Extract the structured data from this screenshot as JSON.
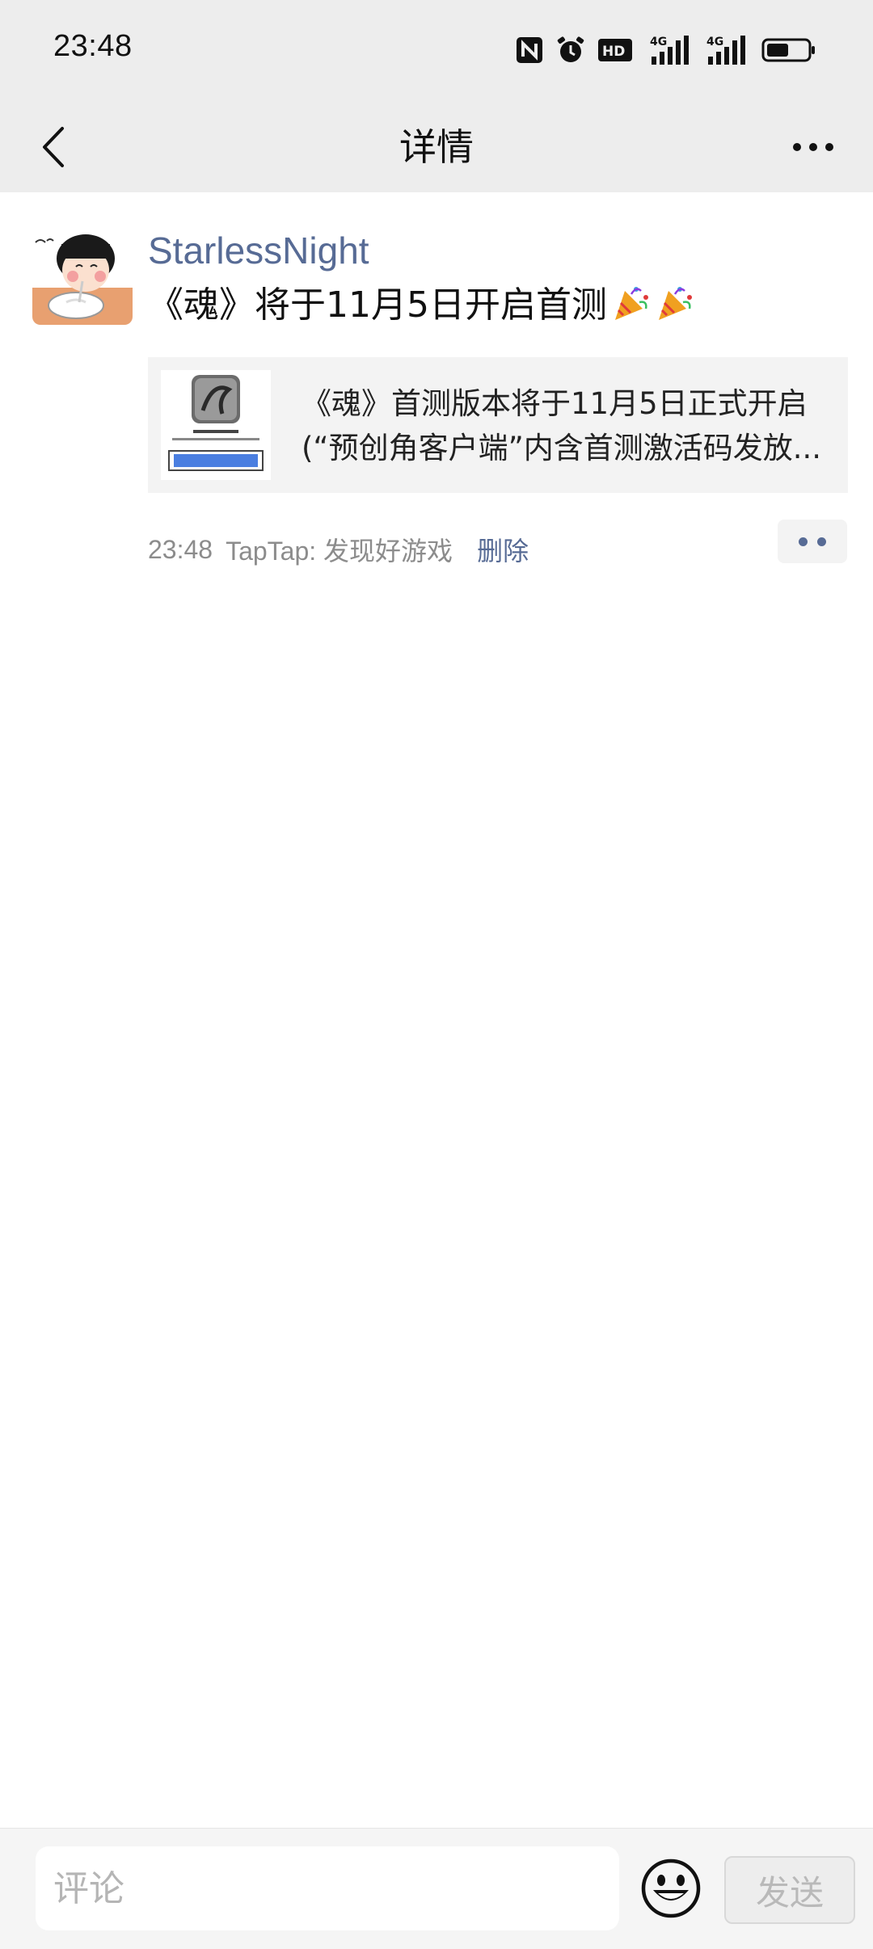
{
  "status_bar": {
    "time": "23:48",
    "icons": [
      "nfc-icon",
      "alarm-icon",
      "hd-icon",
      "signal-4g-icon",
      "signal-4g-icon",
      "battery-icon"
    ],
    "network_label_1": "4G",
    "network_label_2": "4G",
    "hd_label": "HD"
  },
  "nav": {
    "title": "详情",
    "back_icon": "chevron-left-icon",
    "more_icon": "more-icon"
  },
  "post": {
    "author": "StarlessNight",
    "text": "《魂》将于11月5日开启首测",
    "emoji": "party-popper-icon",
    "link_card": {
      "line1": "《魂》首测版本将于11月5日正式开启",
      "line2": "(“预创角客户端”内含首测激活码发放..."
    },
    "time": "23:48",
    "source": "TapTap: 发现好游戏",
    "delete_label": "删除"
  },
  "comment_bar": {
    "placeholder": "评论",
    "send_label": "发送",
    "emoji_icon": "smiley-icon"
  },
  "colors": {
    "link_blue": "#576b95",
    "bar_gray": "#ededed"
  }
}
